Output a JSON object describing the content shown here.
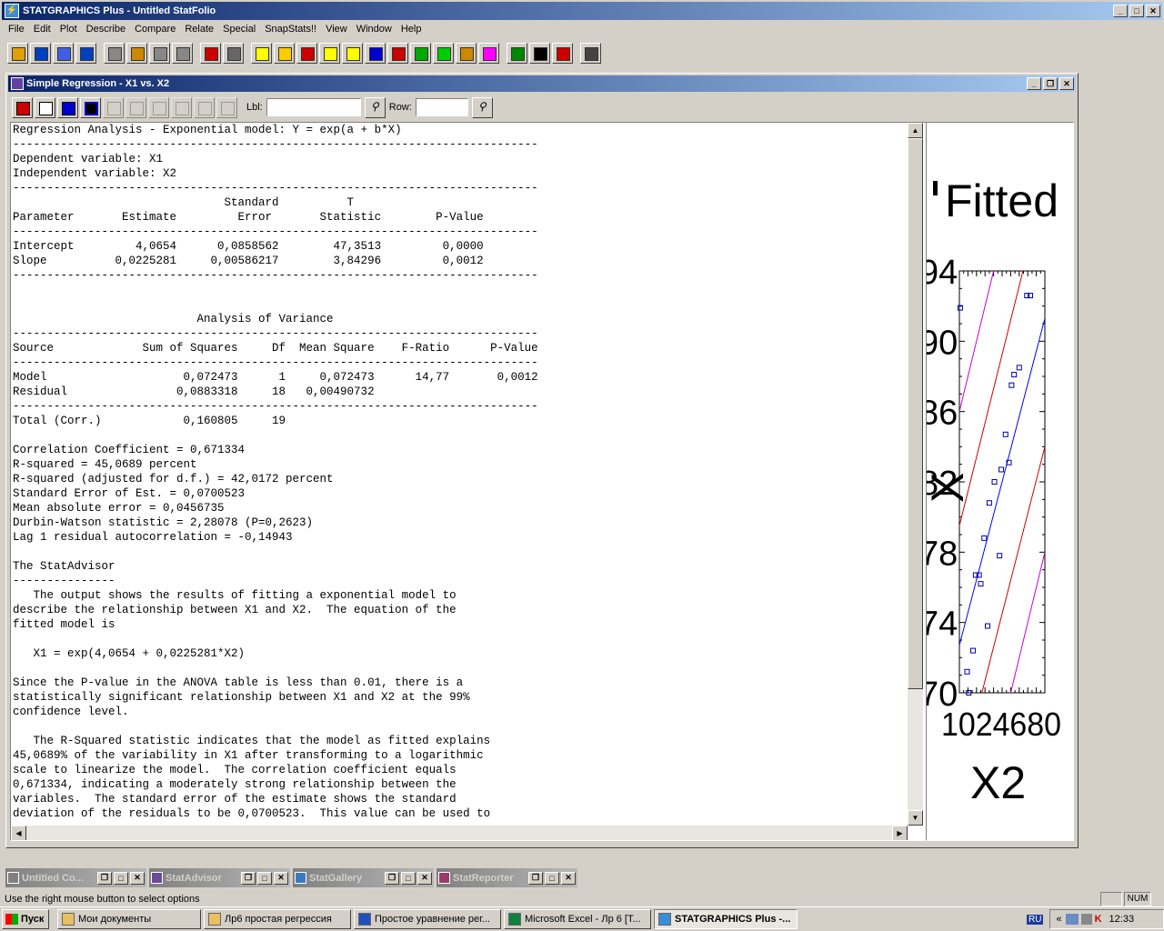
{
  "app": {
    "title": "STATGRAPHICS Plus - Untitled StatFolio",
    "menu": [
      "File",
      "Edit",
      "Plot",
      "Describe",
      "Compare",
      "Relate",
      "Special",
      "SnapStats!!",
      "View",
      "Window",
      "Help"
    ]
  },
  "toolbar": {
    "icons": [
      "open-folder-icon",
      "save-icon",
      "spreadsheet-icon",
      "data-icon",
      "cut-icon",
      "copy-icon",
      "paste-icon",
      "undo-icon",
      "print-icon",
      "print-preview-icon",
      "scatter-icon",
      "stat-icon",
      "bar-chart-icon",
      "cross-icon",
      "grid-chart-icon",
      "line-chart-icon",
      "bell-curve-icon",
      "trend-icon",
      "globe-icon",
      "tree-icon",
      "pink-matrix-icon",
      "green-arrow-icon",
      "wizard-icon",
      "help-icon",
      "calculator-icon"
    ]
  },
  "child_window": {
    "title": "Simple Regression - X1 vs. X2",
    "lbl_label": "Lbl:",
    "lbl_value": "",
    "row_label": "Row:",
    "row_value": ""
  },
  "output": {
    "text": "Regression Analysis - Exponential model: Y = exp(a + b*X)\n-----------------------------------------------------------------------------\nDependent variable: X1\nIndependent variable: X2\n-----------------------------------------------------------------------------\n                               Standard          T\nParameter       Estimate         Error       Statistic        P-Value\n-----------------------------------------------------------------------------\nIntercept         4,0654      0,0858562        47,3513         0,0000\nSlope          0,0225281     0,00586217        3,84296         0,0012\n-----------------------------------------------------------------------------\n\n\n                           Analysis of Variance\n-----------------------------------------------------------------------------\nSource             Sum of Squares     Df  Mean Square    F-Ratio      P-Value\n-----------------------------------------------------------------------------\nModel                    0,072473      1     0,072473      14,77       0,0012\nResidual                0,0883318     18   0,00490732\n-----------------------------------------------------------------------------\nTotal (Corr.)            0,160805     19\n\nCorrelation Coefficient = 0,671334\nR-squared = 45,0689 percent\nR-squared (adjusted for d.f.) = 42,0172 percent\nStandard Error of Est. = 0,0700523\nMean absolute error = 0,0456735\nDurbin-Watson statistic = 2,28078 (P=0,2623)\nLag 1 residual autocorrelation = -0,14943\n\nThe StatAdvisor\n---------------\n   The output shows the results of fitting a exponential model to\ndescribe the relationship between X1 and X2.  The equation of the\nfitted model is\n\n   X1 = exp(4,0654 + 0,0225281*X2)\n\nSince the P-value in the ANOVA table is less than 0.01, there is a\nstatistically significant relationship between X1 and X2 at the 99%\nconfidence level.\n\n   The R-Squared statistic indicates that the model as fitted explains\n45,0689% of the variability in X1 after transforming to a logarithmic\nscale to linearize the model.  The correlation coefficient equals\n0,671334, indicating a moderately strong relationship between the\nvariables.  The standard error of the estimate shows the standard\ndeviation of the residuals to be 0,0700523.  This value can be used to"
  },
  "plot": {
    "title_fragment": "Fitted",
    "ytick_fragments": [
      "94",
      "90",
      "86",
      "82",
      "78",
      "74",
      "70"
    ],
    "ylabel_fragment": "X",
    "xtick_overlap": "1024680",
    "xlabel": "X2"
  },
  "chart_data": {
    "type": "scatter",
    "title": "Fitted",
    "xlabel": "X2",
    "ylabel": "",
    "ylim": [
      70,
      94
    ],
    "xlim": [
      10,
      20
    ],
    "series": [
      {
        "role": "observed",
        "x": [
          10.1,
          10.9,
          11.1,
          11.6,
          11.9,
          12.3,
          12.5,
          12.9,
          13.3,
          13.5,
          14.1,
          14.7,
          14.9,
          15.4,
          15.8,
          16.1,
          16.4,
          17.0,
          17.9,
          18.3
        ],
        "y": [
          91.9,
          71.2,
          70.0,
          72.4,
          76.7,
          76.7,
          76.2,
          78.8,
          73.8,
          80.8,
          82.0,
          77.8,
          82.7,
          84.7,
          83.1,
          87.5,
          88.1,
          88.5,
          92.6,
          92.6
        ]
      },
      {
        "role": "fit",
        "x": [
          10,
          20
        ],
        "y": [
          72.7,
          91.3
        ]
      },
      {
        "role": "confidence-limits",
        "x": [
          10,
          20
        ],
        "y_lower": [
          65.0,
          84.0
        ],
        "y_upper": [
          79.5,
          99.0
        ]
      },
      {
        "role": "prediction-limits",
        "x": [
          10,
          20
        ],
        "y_lower": [
          58.0,
          78.0
        ],
        "y_upper": [
          86.0,
          106.0
        ]
      }
    ]
  },
  "minimized": [
    {
      "title": "Untitled Co...",
      "icon": "statfolio-icon"
    },
    {
      "title": "StatAdvisor",
      "icon": "advisor-icon"
    },
    {
      "title": "StatGallery",
      "icon": "gallery-icon"
    },
    {
      "title": "StatReporter",
      "icon": "reporter-icon"
    }
  ],
  "status": {
    "text": "Use the right mouse button to select options",
    "num": "NUM"
  },
  "taskbar": {
    "start": "Пуск",
    "items": [
      "Мои документы",
      "Лр6 простая регрессия",
      "Простое уравнение рег...",
      "Microsoft Excel - Лр 6  [Т...",
      "STATGRAPHICS Plus -..."
    ],
    "lang": "RU",
    "clock": "12:33"
  },
  "colors": {
    "title_active": "#0a246a",
    "chrome": "#d4d0c8",
    "fit": "#0000ff",
    "confidence": "#cc0000",
    "prediction": "#cc00cc",
    "points": "#0000aa"
  }
}
